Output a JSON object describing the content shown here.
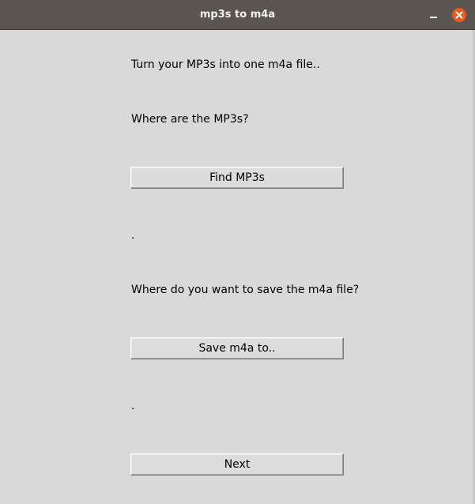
{
  "window": {
    "title": "mp3s to m4a"
  },
  "titlebar": {
    "minimize_icon": "minimize-icon",
    "close_icon": "close-icon",
    "close_color": "#e9581f"
  },
  "main": {
    "intro_text": "Turn your MP3s into one m4a file..",
    "mp3_question": "Where are the MP3s?",
    "find_button_label": "Find MP3s",
    "mp3_path_text": ".",
    "save_question": "Where do you want to save the m4a file?",
    "save_button_label": "Save m4a to..",
    "save_path_text": ".",
    "next_button_label": "Next"
  }
}
